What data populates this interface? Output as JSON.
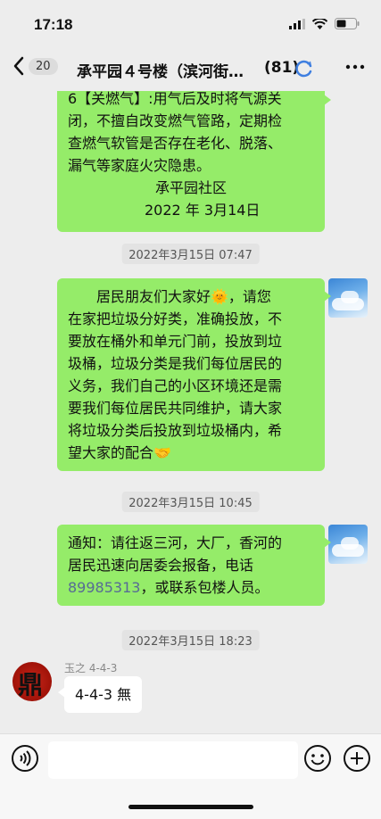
{
  "status_bar": {
    "time": "17:18"
  },
  "nav": {
    "unread_count": "20",
    "title": "承平园４号楼（滨河街…",
    "member_count": "(81)"
  },
  "messages": {
    "msg1_lines": [
      "6【关燃气】:用气后及时将气源关",
      "闭，不擅自改变燃气管路，定期检",
      "查燃气软管是否存在老化、脱落、",
      "漏气等家庭火灾隐患。"
    ],
    "msg1_signature": "承平园社区",
    "msg1_date": "2022 年 3月14日",
    "ts1": "2022年3月15日 07:47",
    "msg2_lines": [
      "居民朋友们大家好🌞，请您",
      "在家把垃圾分好类，准确投放，不",
      "要放在桶外和单元门前，投放到垃",
      "圾桶，垃圾分类是我们每位居民的",
      "义务，我们自己的小区环境还是需",
      "要我们每位居民共同维护，请大家",
      "将垃圾分类后投放到垃圾桶内，希",
      "望大家的配合🤝"
    ],
    "ts2": "2022年3月15日 10:45",
    "msg3_line1": "通知：请往返三河，大厂，香河的",
    "msg3_line2": "居民迅速向居委会报备，电话",
    "msg3_phone": "89985313",
    "msg3_line3_rest": "，或联系包楼人员。",
    "ts3": "2022年3月15日 18:23",
    "sender_name": "玉之 4-4-3",
    "msg4_text": "4-4-3 無"
  },
  "icons": {
    "back": "chevron-left-icon",
    "refresh": "refresh-icon",
    "more": "more-icon",
    "voice": "voice-icon",
    "emoji": "emoji-icon",
    "plus": "plus-icon"
  },
  "colors": {
    "bubble_green": "#95ec69",
    "background": "#ededed",
    "link": "#576b95"
  }
}
